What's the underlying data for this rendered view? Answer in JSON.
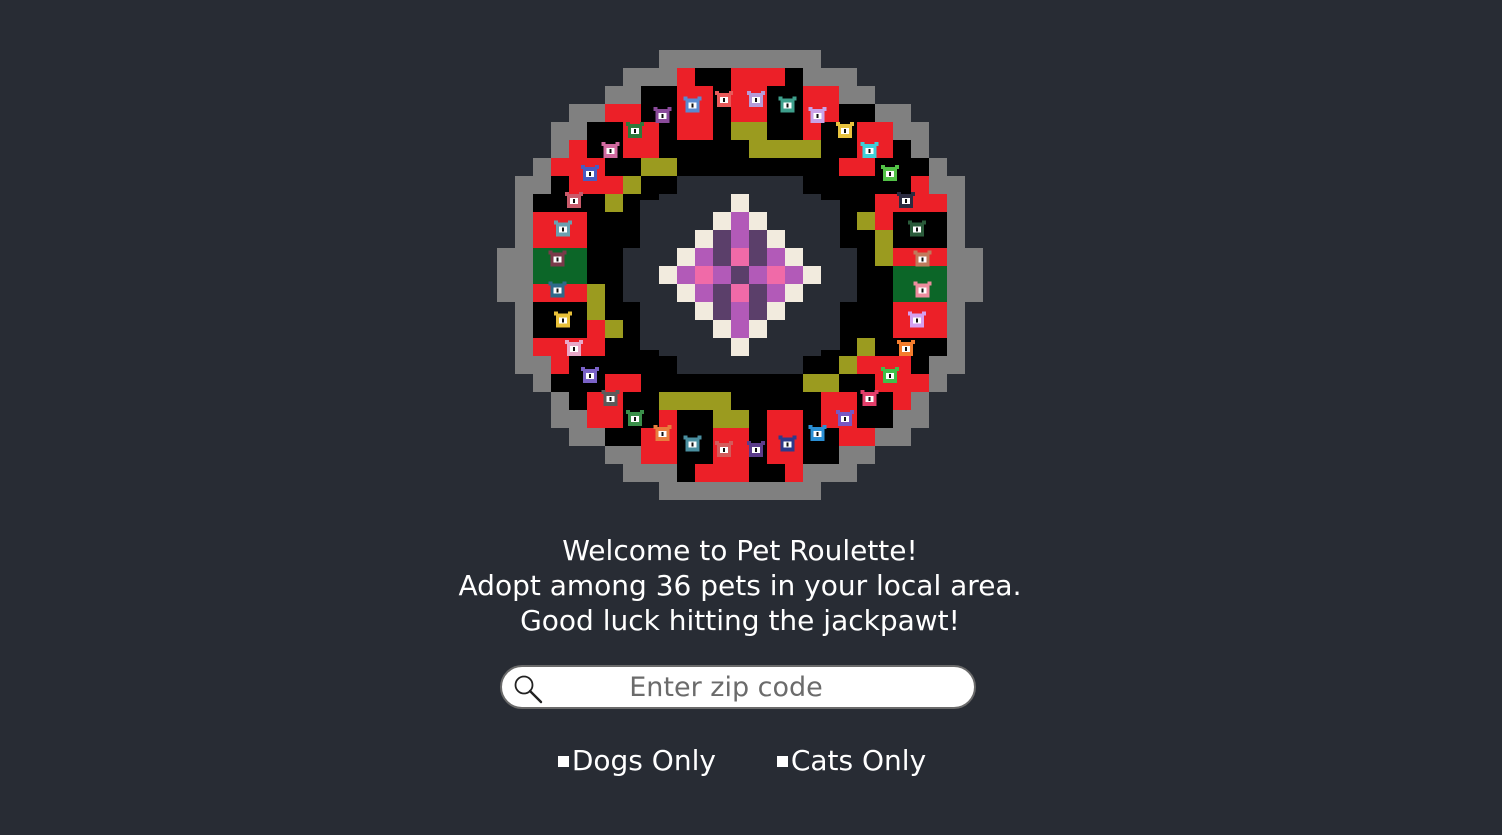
{
  "welcome": {
    "line1": "Welcome to Pet Roulette!",
    "line2": "Adopt among 36 pets in your local area.",
    "line3": "Good luck hitting the jackpawt!"
  },
  "search": {
    "placeholder": "Enter zip code",
    "value": ""
  },
  "filters": {
    "dogs_label": "Dogs Only",
    "cats_label": "Cats Only"
  },
  "wheel": {
    "slot_count": 36,
    "colors": {
      "rim": "#808080",
      "red": "#ec2028",
      "black": "#000000",
      "green": "#0c6628",
      "gold": "#9b9b1f",
      "center_cream": "#f2ebde",
      "center_pink": "#f06aa8",
      "center_purple": "#b25ab8",
      "center_dark": "#5b3f6a"
    },
    "pet_colors": [
      "#b59cd9",
      "#3e9f8c",
      "#c8a3e8",
      "#e7c23e",
      "#3fd0d8",
      "#52c247",
      "#2b2b40",
      "#2a5b3a",
      "#c07a5c",
      "#ec8d9e",
      "#d4a0f0",
      "#f47d2d",
      "#3fc04a",
      "#e23e6a",
      "#7858c2",
      "#2a8fd4",
      "#2e3a8a",
      "#5b3c8a",
      "#d45b5b",
      "#4a8fa0",
      "#e87d3e",
      "#3a8f4a",
      "#5b5b5b",
      "#7a62c8",
      "#e8a8c8",
      "#e8c038",
      "#2e6a8a",
      "#7a3a4a",
      "#6aa0b0",
      "#c85a6a",
      "#4a5bc0",
      "#d06aa0",
      "#2e7a3a",
      "#8a4a9a",
      "#5a8ad0",
      "#e85a5a"
    ]
  }
}
